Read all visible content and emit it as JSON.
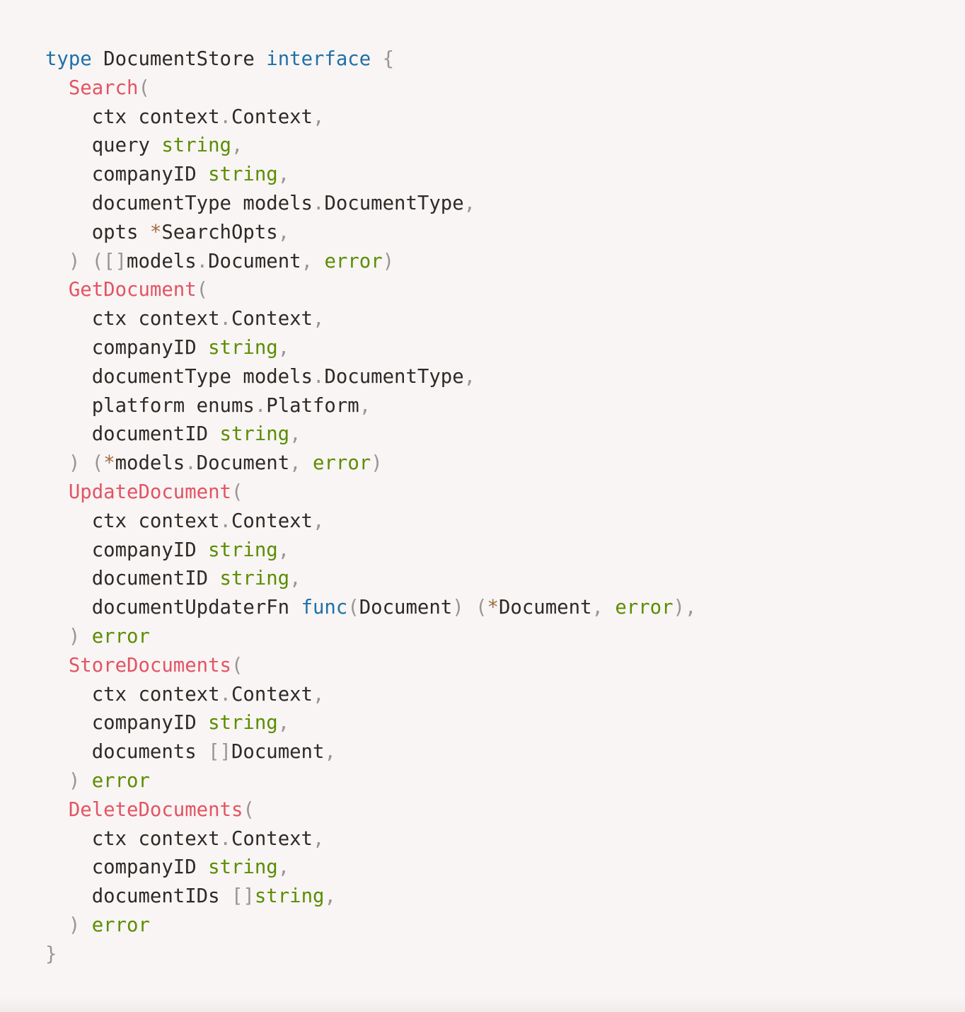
{
  "colors": {
    "background": "#f8f5f4",
    "plain": "#2f2a27",
    "keyword": "#1f70a8",
    "function_name": "#e45363",
    "builtin_type": "#5b8d00",
    "punctuation": "#9a9594",
    "operator": "#a36b3c"
  },
  "code_lines": [
    [
      [
        "type",
        "keyword"
      ],
      [
        " DocumentStore ",
        "plain"
      ],
      [
        "interface",
        "keyword"
      ],
      [
        " ",
        "plain"
      ],
      [
        "{",
        "punctuation"
      ]
    ],
    [
      [
        "  ",
        "plain"
      ],
      [
        "Search",
        "function_name"
      ],
      [
        "(",
        "punctuation"
      ]
    ],
    [
      [
        "    ctx context",
        "plain"
      ],
      [
        ".",
        "punctuation"
      ],
      [
        "Context",
        "plain"
      ],
      [
        ",",
        "punctuation"
      ]
    ],
    [
      [
        "    query ",
        "plain"
      ],
      [
        "string",
        "builtin_type"
      ],
      [
        ",",
        "punctuation"
      ]
    ],
    [
      [
        "    companyID ",
        "plain"
      ],
      [
        "string",
        "builtin_type"
      ],
      [
        ",",
        "punctuation"
      ]
    ],
    [
      [
        "    documentType models",
        "plain"
      ],
      [
        ".",
        "punctuation"
      ],
      [
        "DocumentType",
        "plain"
      ],
      [
        ",",
        "punctuation"
      ]
    ],
    [
      [
        "    opts ",
        "plain"
      ],
      [
        "*",
        "operator"
      ],
      [
        "SearchOpts",
        "plain"
      ],
      [
        ",",
        "punctuation"
      ]
    ],
    [
      [
        "  ",
        "plain"
      ],
      [
        ") ([]",
        "punctuation"
      ],
      [
        "models",
        "plain"
      ],
      [
        ".",
        "punctuation"
      ],
      [
        "Document",
        "plain"
      ],
      [
        ", ",
        "punctuation"
      ],
      [
        "error",
        "builtin_type"
      ],
      [
        ")",
        "punctuation"
      ]
    ],
    [
      [
        "  ",
        "plain"
      ],
      [
        "GetDocument",
        "function_name"
      ],
      [
        "(",
        "punctuation"
      ]
    ],
    [
      [
        "    ctx context",
        "plain"
      ],
      [
        ".",
        "punctuation"
      ],
      [
        "Context",
        "plain"
      ],
      [
        ",",
        "punctuation"
      ]
    ],
    [
      [
        "    companyID ",
        "plain"
      ],
      [
        "string",
        "builtin_type"
      ],
      [
        ",",
        "punctuation"
      ]
    ],
    [
      [
        "    documentType models",
        "plain"
      ],
      [
        ".",
        "punctuation"
      ],
      [
        "DocumentType",
        "plain"
      ],
      [
        ",",
        "punctuation"
      ]
    ],
    [
      [
        "    platform enums",
        "plain"
      ],
      [
        ".",
        "punctuation"
      ],
      [
        "Platform",
        "plain"
      ],
      [
        ",",
        "punctuation"
      ]
    ],
    [
      [
        "    documentID ",
        "plain"
      ],
      [
        "string",
        "builtin_type"
      ],
      [
        ",",
        "punctuation"
      ]
    ],
    [
      [
        "  ",
        "plain"
      ],
      [
        ") (",
        "punctuation"
      ],
      [
        "*",
        "operator"
      ],
      [
        "models",
        "plain"
      ],
      [
        ".",
        "punctuation"
      ],
      [
        "Document",
        "plain"
      ],
      [
        ", ",
        "punctuation"
      ],
      [
        "error",
        "builtin_type"
      ],
      [
        ")",
        "punctuation"
      ]
    ],
    [
      [
        "  ",
        "plain"
      ],
      [
        "UpdateDocument",
        "function_name"
      ],
      [
        "(",
        "punctuation"
      ]
    ],
    [
      [
        "    ctx context",
        "plain"
      ],
      [
        ".",
        "punctuation"
      ],
      [
        "Context",
        "plain"
      ],
      [
        ",",
        "punctuation"
      ]
    ],
    [
      [
        "    companyID ",
        "plain"
      ],
      [
        "string",
        "builtin_type"
      ],
      [
        ",",
        "punctuation"
      ]
    ],
    [
      [
        "    documentID ",
        "plain"
      ],
      [
        "string",
        "builtin_type"
      ],
      [
        ",",
        "punctuation"
      ]
    ],
    [
      [
        "    documentUpdaterFn ",
        "plain"
      ],
      [
        "func",
        "keyword"
      ],
      [
        "(",
        "punctuation"
      ],
      [
        "Document",
        "plain"
      ],
      [
        ") (",
        "punctuation"
      ],
      [
        "*",
        "operator"
      ],
      [
        "Document",
        "plain"
      ],
      [
        ", ",
        "punctuation"
      ],
      [
        "error",
        "builtin_type"
      ],
      [
        "),",
        "punctuation"
      ]
    ],
    [
      [
        "  ",
        "plain"
      ],
      [
        ") ",
        "punctuation"
      ],
      [
        "error",
        "builtin_type"
      ]
    ],
    [
      [
        "  ",
        "plain"
      ],
      [
        "StoreDocuments",
        "function_name"
      ],
      [
        "(",
        "punctuation"
      ]
    ],
    [
      [
        "    ctx context",
        "plain"
      ],
      [
        ".",
        "punctuation"
      ],
      [
        "Context",
        "plain"
      ],
      [
        ",",
        "punctuation"
      ]
    ],
    [
      [
        "    companyID ",
        "plain"
      ],
      [
        "string",
        "builtin_type"
      ],
      [
        ",",
        "punctuation"
      ]
    ],
    [
      [
        "    documents ",
        "plain"
      ],
      [
        "[]",
        "punctuation"
      ],
      [
        "Document",
        "plain"
      ],
      [
        ",",
        "punctuation"
      ]
    ],
    [
      [
        "  ",
        "plain"
      ],
      [
        ") ",
        "punctuation"
      ],
      [
        "error",
        "builtin_type"
      ]
    ],
    [
      [
        "  ",
        "plain"
      ],
      [
        "DeleteDocuments",
        "function_name"
      ],
      [
        "(",
        "punctuation"
      ]
    ],
    [
      [
        "    ctx context",
        "plain"
      ],
      [
        ".",
        "punctuation"
      ],
      [
        "Context",
        "plain"
      ],
      [
        ",",
        "punctuation"
      ]
    ],
    [
      [
        "    companyID ",
        "plain"
      ],
      [
        "string",
        "builtin_type"
      ],
      [
        ",",
        "punctuation"
      ]
    ],
    [
      [
        "    documentIDs ",
        "plain"
      ],
      [
        "[]",
        "punctuation"
      ],
      [
        "string",
        "builtin_type"
      ],
      [
        ",",
        "punctuation"
      ]
    ],
    [
      [
        "  ",
        "plain"
      ],
      [
        ") ",
        "punctuation"
      ],
      [
        "error",
        "builtin_type"
      ]
    ],
    [
      [
        "}",
        "punctuation"
      ]
    ]
  ]
}
